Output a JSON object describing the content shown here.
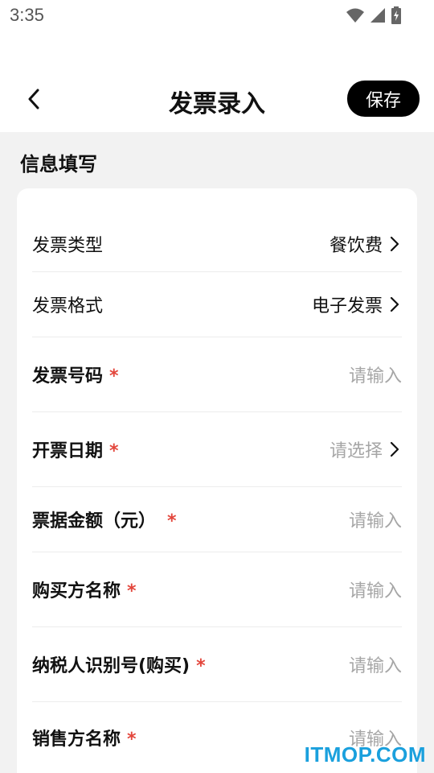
{
  "status_bar": {
    "time": "3:35"
  },
  "nav": {
    "title": "发票录入",
    "save_label": "保存"
  },
  "section": {
    "title": "信息填写"
  },
  "form": {
    "rows": [
      {
        "label": "发票类型",
        "value": "餐饮费",
        "required": false
      },
      {
        "label": "发票格式",
        "value": "电子发票",
        "required": false
      },
      {
        "label": "发票号码",
        "placeholder": "请输入",
        "required": true
      },
      {
        "label": "开票日期",
        "placeholder": "请选择",
        "required": true
      },
      {
        "label": "票据金额（元）",
        "placeholder": "请输入",
        "required": true
      },
      {
        "label": "购买方名称",
        "placeholder": "请输入",
        "required": true
      },
      {
        "label": "纳税人识别号(购买)",
        "placeholder": "请输入",
        "required": true
      },
      {
        "label": "销售方名称",
        "placeholder": "请输入",
        "required": true
      }
    ],
    "required_mark": "*"
  },
  "watermark": "ITMOP.COM",
  "colors": {
    "accent": "#000000",
    "required": "#e3463c",
    "placeholder": "#a6a6a6",
    "watermark": "#1aa0dd"
  }
}
